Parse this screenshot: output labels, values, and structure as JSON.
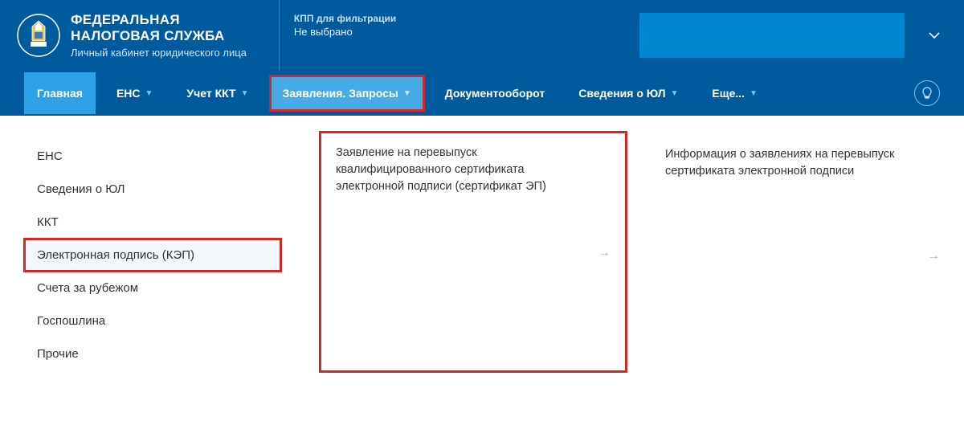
{
  "header": {
    "title_line1": "ФЕДЕРАЛЬНАЯ",
    "title_line2": "НАЛОГОВАЯ СЛУЖБА",
    "subtitle": "Личный кабинет юридического лица",
    "kpp_label": "КПП для фильтрации",
    "kpp_value": "Не выбрано"
  },
  "nav": {
    "home": "Главная",
    "ens": "ЕНС",
    "kkt": "Учет ККТ",
    "requests": "Заявления. Запросы",
    "docflow": "Документооборот",
    "entity_info": "Сведения о ЮЛ",
    "more": "Еще..."
  },
  "sidebar": {
    "items": [
      "ЕНС",
      "Сведения о ЮЛ",
      "ККТ",
      "Электронная подпись (КЭП)",
      "Счета за рубежом",
      "Госпошлина",
      "Прочие"
    ]
  },
  "cards": {
    "reissue": "Заявление на перевыпуск квалифицированного сертификата электронной подписи (сертификат ЭП)",
    "info": "Информация о заявлениях на перевыпуск сертификата электронной подписи"
  }
}
